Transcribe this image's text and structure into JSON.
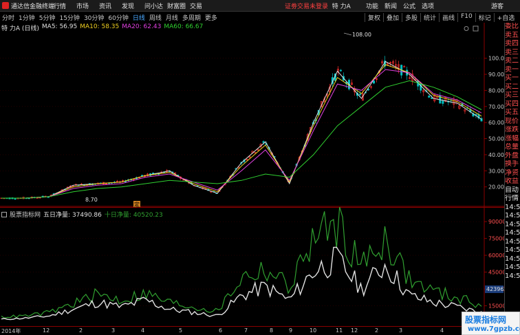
{
  "app": {
    "title": "通达信金融终端",
    "guest": "游客",
    "notice": "证劵交易未登录"
  },
  "menu": [
    "行情",
    "市场",
    "资讯",
    "发现",
    "问小达",
    "财富圈",
    "交易"
  ],
  "stock_tag": "特 力A",
  "top_right": [
    "功能",
    "新闻",
    "公式",
    "选项"
  ],
  "periods": [
    {
      "label": "分时",
      "active": false
    },
    {
      "label": "1分钟",
      "active": false
    },
    {
      "label": "5分钟",
      "active": false
    },
    {
      "label": "15分钟",
      "active": false
    },
    {
      "label": "30分钟",
      "active": false
    },
    {
      "label": "60分钟",
      "active": false
    },
    {
      "label": "日线",
      "active": true
    },
    {
      "label": "周线",
      "active": false
    },
    {
      "label": "月线",
      "active": false
    },
    {
      "label": "多周期",
      "active": false
    },
    {
      "label": "更多",
      "active": false
    }
  ],
  "tools": [
    "复权",
    "叠加",
    "多股",
    "统计",
    "画线",
    "F10",
    "标记",
    "+自选"
  ],
  "main_legend": {
    "name": "特 力A (日线)",
    "items": [
      {
        "text": "MA5: 56.95",
        "color": "#e0e0e0"
      },
      {
        "text": "MA10: 58.35",
        "color": "#f0d020"
      },
      {
        "text": "MA20: 62.43",
        "color": "#e040e0"
      },
      {
        "text": "MA60: 66.67",
        "color": "#30d030"
      }
    ]
  },
  "price_axis": [
    "100.0",
    "90.00",
    "80.00",
    "70.00",
    "60.00",
    "50.00",
    "40.00",
    "30.00",
    "20.00"
  ],
  "annotations": {
    "high": "108.00",
    "low": "8.70",
    "marker": "定"
  },
  "indicator_legend": {
    "source": "股票指标网",
    "label": "五日净量",
    "value": "37490.86",
    "label2": "十日净量",
    "value2": "40520.23",
    "color1": "#e0e0e0",
    "color2": "#30a030"
  },
  "vol_axis": [
    "90000",
    "75000",
    "60000",
    "45000",
    "30000",
    "15000"
  ],
  "vol_current": "42396",
  "right_panel": [
    "委比",
    "卖五",
    "卖四",
    "卖三",
    "卖二",
    "卖一",
    "买一",
    "买二",
    "买三",
    "买四",
    "买五",
    "现价",
    "涨跌",
    "涨幅",
    "总量",
    "外盘",
    "换手",
    "净资",
    "收益",
    "自动",
    "行情",
    "14:5",
    "14:5",
    "14:5",
    "14:5",
    "14:5",
    "14:5",
    "14:5",
    "14:5",
    "14:5"
  ],
  "time_axis": [
    "2014年",
    "12",
    "2",
    "3",
    "4",
    "5",
    "6",
    "7",
    "8",
    "9",
    "10",
    "11",
    "12",
    "2",
    "3",
    "4"
  ],
  "watermark": {
    "name": "股票指标网",
    "url": "www.7gpzb.com"
  },
  "colors": {
    "up": "#ff3030",
    "down": "#00c0c0",
    "axis": "#8b0000"
  },
  "chart_data": [
    {
      "type": "line",
      "title": "特 力A (日线)",
      "ylim": [
        8,
        112
      ],
      "x": [
        0,
        5,
        10,
        15,
        20,
        25,
        30,
        35,
        40,
        45,
        50,
        55,
        60,
        65,
        70,
        75,
        80,
        85,
        90,
        95,
        100
      ],
      "series": [
        {
          "name": "MA5",
          "values": [
            13,
            13,
            14,
            21,
            22,
            23,
            27,
            30,
            21,
            16,
            35,
            48,
            22,
            60,
            92,
            75,
            98,
            90,
            75,
            72,
            62
          ]
        },
        {
          "name": "MA10",
          "values": [
            13,
            13,
            14,
            20,
            22,
            23,
            27,
            29,
            22,
            17,
            33,
            46,
            23,
            58,
            88,
            78,
            96,
            91,
            77,
            73,
            64
          ]
        },
        {
          "name": "MA20",
          "values": [
            13,
            13,
            14,
            19,
            21,
            22,
            26,
            28,
            23,
            18,
            30,
            43,
            24,
            55,
            84,
            80,
            93,
            91,
            78,
            74,
            66
          ]
        },
        {
          "name": "MA60",
          "values": [
            13,
            13,
            14,
            17,
            19,
            20,
            22,
            24,
            23,
            22,
            24,
            28,
            26,
            40,
            58,
            70,
            82,
            86,
            82,
            76,
            68
          ]
        }
      ]
    },
    {
      "type": "line",
      "ylim": [
        0,
        95000
      ],
      "x": [
        0,
        5,
        10,
        15,
        20,
        25,
        30,
        35,
        40,
        45,
        50,
        55,
        60,
        65,
        70,
        75,
        80,
        85,
        90,
        95,
        100
      ],
      "series": [
        {
          "name": "五日净量",
          "values": [
            3000,
            4000,
            6000,
            12000,
            18000,
            14000,
            20000,
            12000,
            9000,
            6000,
            24000,
            32000,
            20000,
            46000,
            56000,
            30000,
            52000,
            24000,
            18000,
            14000,
            9000
          ]
        },
        {
          "name": "十日净量",
          "values": [
            5000,
            6000,
            9000,
            17000,
            25000,
            20000,
            26000,
            18000,
            14000,
            10000,
            40000,
            48000,
            32000,
            75000,
            88000,
            50000,
            76000,
            38000,
            28000,
            22000,
            16000
          ]
        }
      ]
    }
  ]
}
